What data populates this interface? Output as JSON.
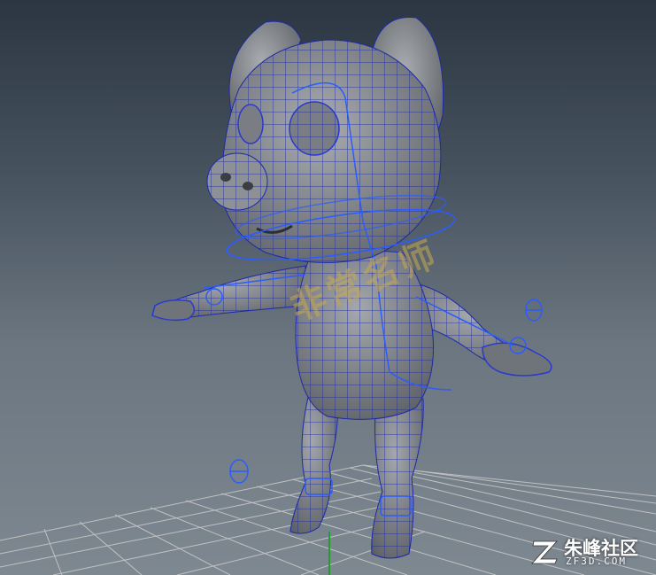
{
  "viewport": {
    "watermark_text": "非常名师",
    "background_top": "#2b3642",
    "background_bottom": "#7e8891"
  },
  "model": {
    "body_color": "#8f9296",
    "wire_color": "#1c2aa8",
    "rig_color": "#2a5cff",
    "grid_color": "#c8c8c8",
    "axis_color": "#1ea02a"
  },
  "logo": {
    "cn_text": "朱峰社区",
    "en_text": "ZF3D.COM",
    "icon": "z-logo-icon"
  }
}
